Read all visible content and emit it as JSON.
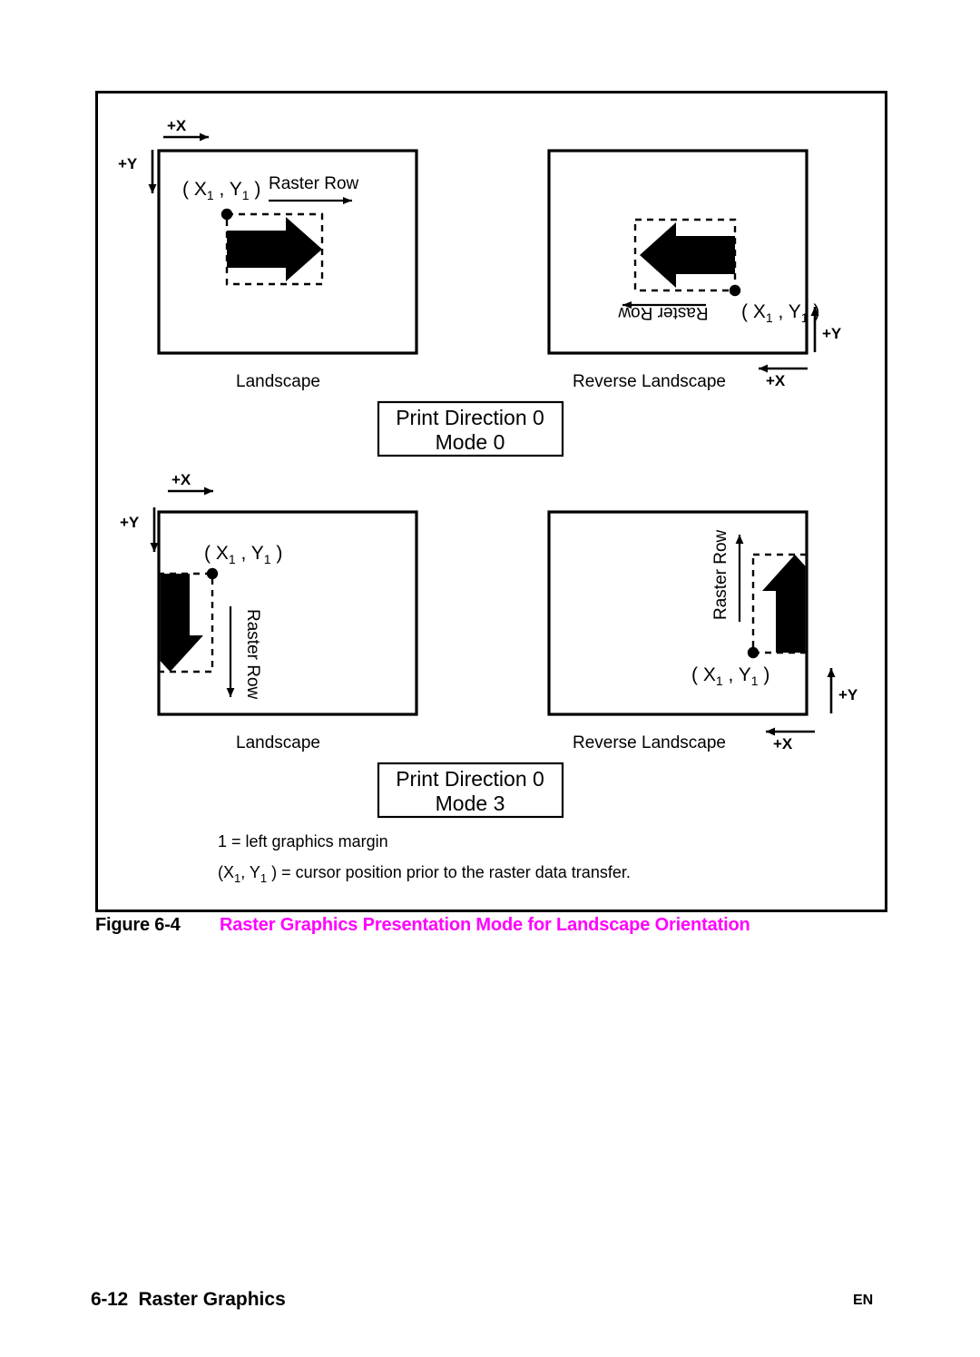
{
  "page": {
    "footer_page": "6-12",
    "footer_section": "Raster Graphics",
    "footer_lang": "EN"
  },
  "caption": {
    "number": "Figure 6-4",
    "title": "Raster Graphics Presentation Mode for Landscape Orientation",
    "color": "#ff00ff"
  },
  "figure": {
    "panels": [
      {
        "id": "top-left",
        "orientation_label": "Landscape",
        "raster_row_label": "Raster Row",
        "coordinate_label": "( X1 , Y1 )",
        "axis_x_label": "+X",
        "axis_y_label": "+Y",
        "arrow_direction": "right",
        "raster_row_direction": "right",
        "axis_x_direction": "right",
        "axis_y_direction": "down"
      },
      {
        "id": "top-right",
        "orientation_label": "Reverse Landscape",
        "raster_row_label": "Raster Row",
        "coordinate_label": "( X1 , Y1 )",
        "axis_x_label": "+X",
        "axis_y_label": "+Y",
        "arrow_direction": "left",
        "raster_row_direction": "left",
        "axis_x_direction": "left",
        "axis_y_direction": "up"
      },
      {
        "id": "bottom-left",
        "orientation_label": "Landscape",
        "raster_row_label": "Raster Row",
        "coordinate_label": "( X1 , Y1 )",
        "axis_x_label": "+X",
        "axis_y_label": "+Y",
        "arrow_direction": "down",
        "raster_row_direction": "down",
        "axis_x_direction": "right",
        "axis_y_direction": "down"
      },
      {
        "id": "bottom-right",
        "orientation_label": "Reverse Landscape",
        "raster_row_label": "Raster Row",
        "coordinate_label": "( X1 , Y1 )",
        "axis_x_label": "+X",
        "axis_y_label": "+Y",
        "arrow_direction": "up",
        "raster_row_direction": "up",
        "axis_x_direction": "left",
        "axis_y_direction": "up"
      }
    ],
    "print_direction_boxes": [
      {
        "id": "mode-0",
        "line1": "Print  Direction  0",
        "line2": "Mode  0"
      },
      {
        "id": "mode-3",
        "line1": "Print  Direction  0",
        "line2": "Mode  3"
      }
    ],
    "legend": [
      {
        "id": "left-margin",
        "text": "1  =  left  graphics  margin"
      },
      {
        "id": "cursor-position",
        "prefix": "(X",
        "sub1": "1",
        "mid": ",  Y",
        "sub2": "1",
        "text": " )  =  cursor  position  prior  to  the  raster  data  transfer."
      }
    ]
  }
}
